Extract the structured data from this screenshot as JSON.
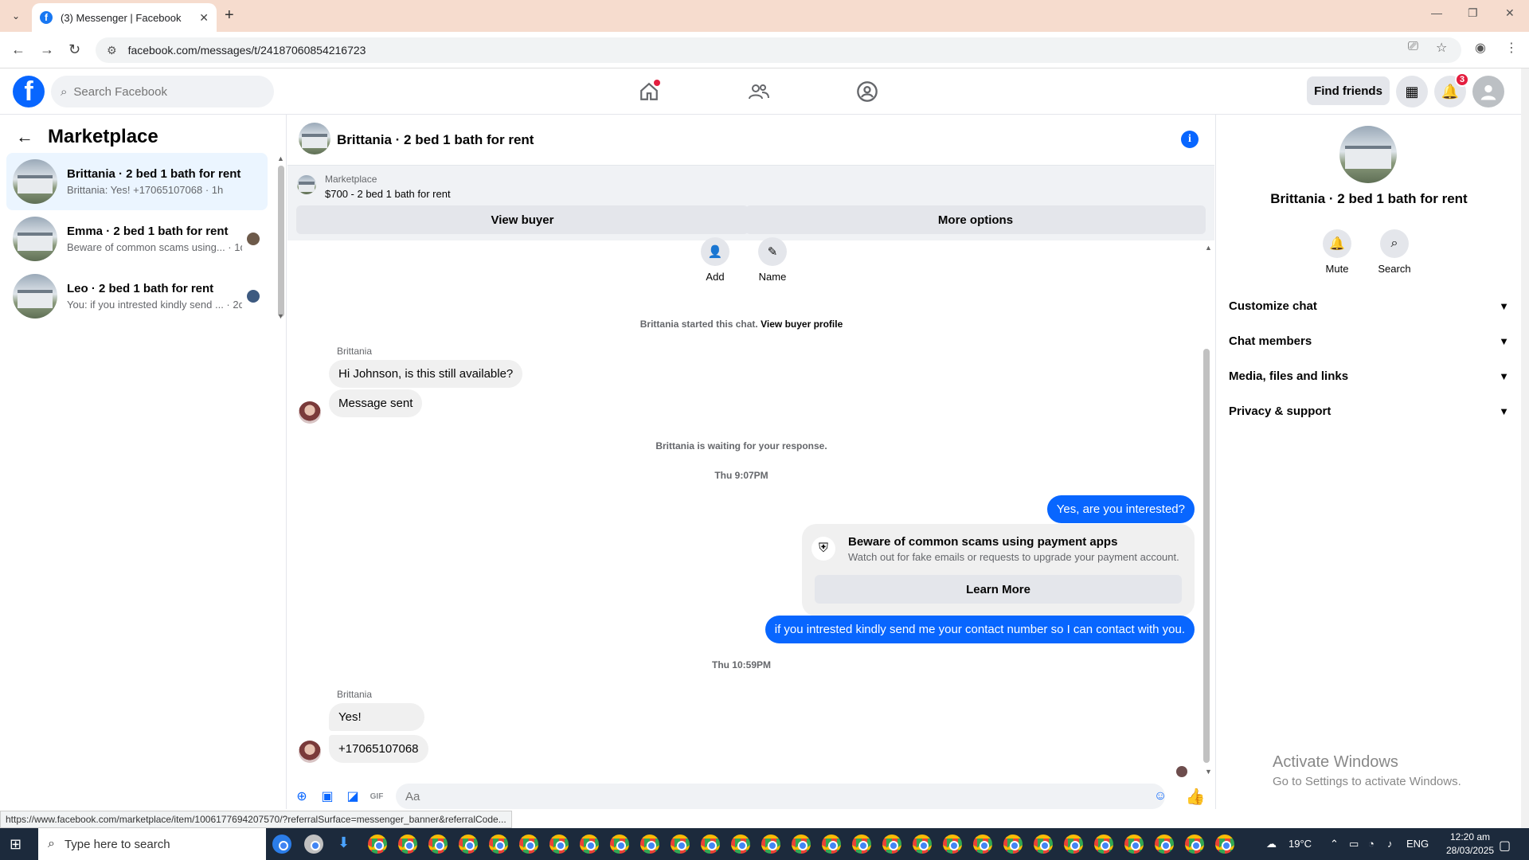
{
  "browser": {
    "tab_title": "(3) Messenger | Facebook",
    "url": "facebook.com/messages/t/24187060854216723",
    "status_url": "https://www.facebook.com/marketplace/item/1006177694207570/?referralSurface=messenger_banner&referralCode..."
  },
  "fb": {
    "logo": "f",
    "search_placeholder": "Search Facebook",
    "find_friends": "Find friends",
    "notif_count": "3"
  },
  "sidebar": {
    "title": "Marketplace",
    "conversations": [
      {
        "name": "Brittania · 2 bed 1 bath for rent",
        "preview": "Brittania: Yes! +17065107068 · 1h"
      },
      {
        "name": "Emma · 2 bed 1 bath for rent",
        "preview": "Beware of common scams using... · 1d"
      },
      {
        "name": "Leo · 2 bed 1 bath for rent",
        "preview": "You: if you intrested kindly send ... · 2d"
      }
    ]
  },
  "chat": {
    "title": "Brittania · 2 bed 1 bath for rent",
    "banner_source": "Marketplace",
    "banner_listing": "$700 - 2 bed 1 bath for rent",
    "view_buyer": "View buyer",
    "more_options": "More options",
    "add_label": "Add",
    "name_label": "Name",
    "started_text": "Brittania started this chat.",
    "view_buyer_profile": "View buyer profile",
    "sender_1": "Brittania",
    "msg_1": "Hi Johnson, is this still available?",
    "msg_2": "Message sent",
    "waiting": "Brittania is waiting for your response.",
    "time_1": "Thu 9:07PM",
    "out_1": "Yes, are you interested?",
    "scam_title": "Beware of common scams using payment apps",
    "scam_desc": "Watch out for fake emails or requests to upgrade your payment account.",
    "learn_more": "Learn More",
    "out_2": "if you intrested kindly send me your contact number so I can contact with you.",
    "time_2": "Thu 10:59PM",
    "sender_2": "Brittania",
    "msg_3": "Yes!",
    "msg_4": "+17065107068",
    "composer_placeholder": "Aa"
  },
  "rpanel": {
    "name": "Brittania · 2 bed 1 bath for rent",
    "mute": "Mute",
    "search": "Search",
    "rows": [
      "Customize chat",
      "Chat members",
      "Media, files and links",
      "Privacy & support"
    ]
  },
  "watermark": {
    "line1": "Activate Windows",
    "line2": "Go to Settings to activate Windows."
  },
  "taskbar": {
    "search_placeholder": "Type here to search",
    "weather": "19°C",
    "lang": "ENG",
    "time": "12:20 am",
    "date": "28/03/2025"
  },
  "colors": {
    "brand": "#0866ff",
    "badge": "#e41e3f"
  }
}
